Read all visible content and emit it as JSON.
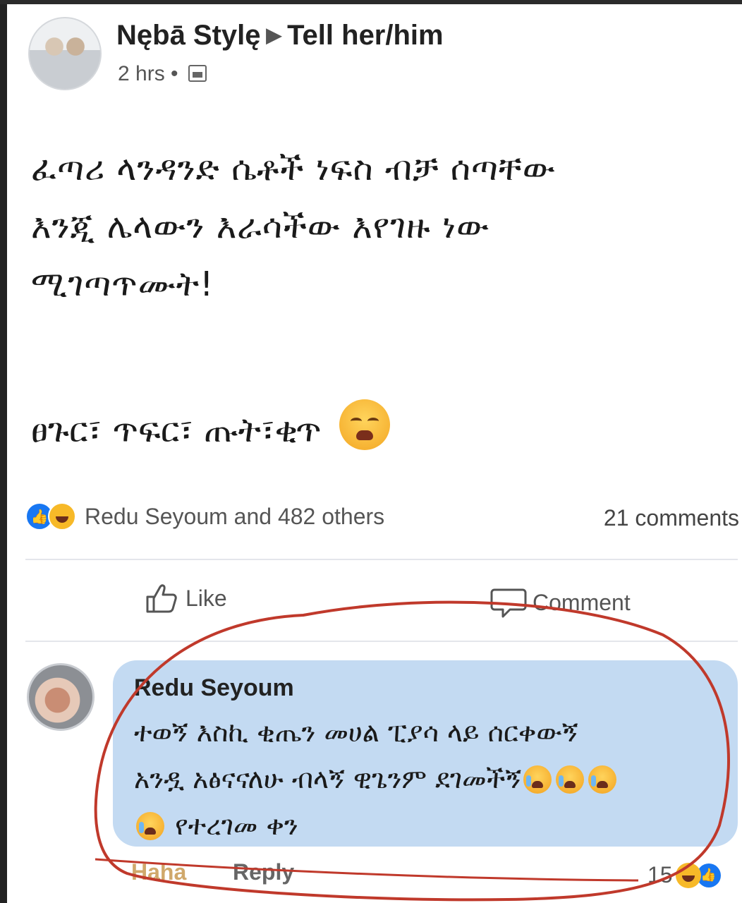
{
  "post": {
    "page_name": "Nębā Stylę",
    "arrow": "▶",
    "target": "Tell her/him",
    "time": "2 hrs •",
    "text_lines": [
      "ፈጣሪ ላንዳንድ ሴቶች ነፍስ ብቻ ሰጣቸው",
      "እንጂ ሌላውን እራሳችው እየገዙ ነው",
      "ሚገጣጥሙት!"
    ],
    "extra_line": "ፀጉር፣ ጥፍር፣ ጡት፣ቂጥ",
    "emoji": "tired-face-emoji"
  },
  "reactions": {
    "summary": "Redu Seyoum and 482 others",
    "comments": "21 comments",
    "like_badge_icon": "like-thumb-icon",
    "haha_badge_icon": "haha-face-icon"
  },
  "actions": {
    "like": "Like",
    "comment": "Comment"
  },
  "comment": {
    "name": "Redu Seyoum",
    "line1": "ተወኝ እስኪ ቂጤን መሀል ፒያሳ ላይ ሰርቀውኝ",
    "line2": "አንዷ አፅናናለሁ ብላኝ ዊጌንም ደገመችኝ",
    "line3": "የተረገመ ቀን",
    "haha": "Haha",
    "reply": "Reply",
    "reaction_count": "15"
  },
  "colors": {
    "accent_blue": "#1877f2",
    "bubble": "#c3daf2",
    "highlight_red": "#c0392b"
  }
}
